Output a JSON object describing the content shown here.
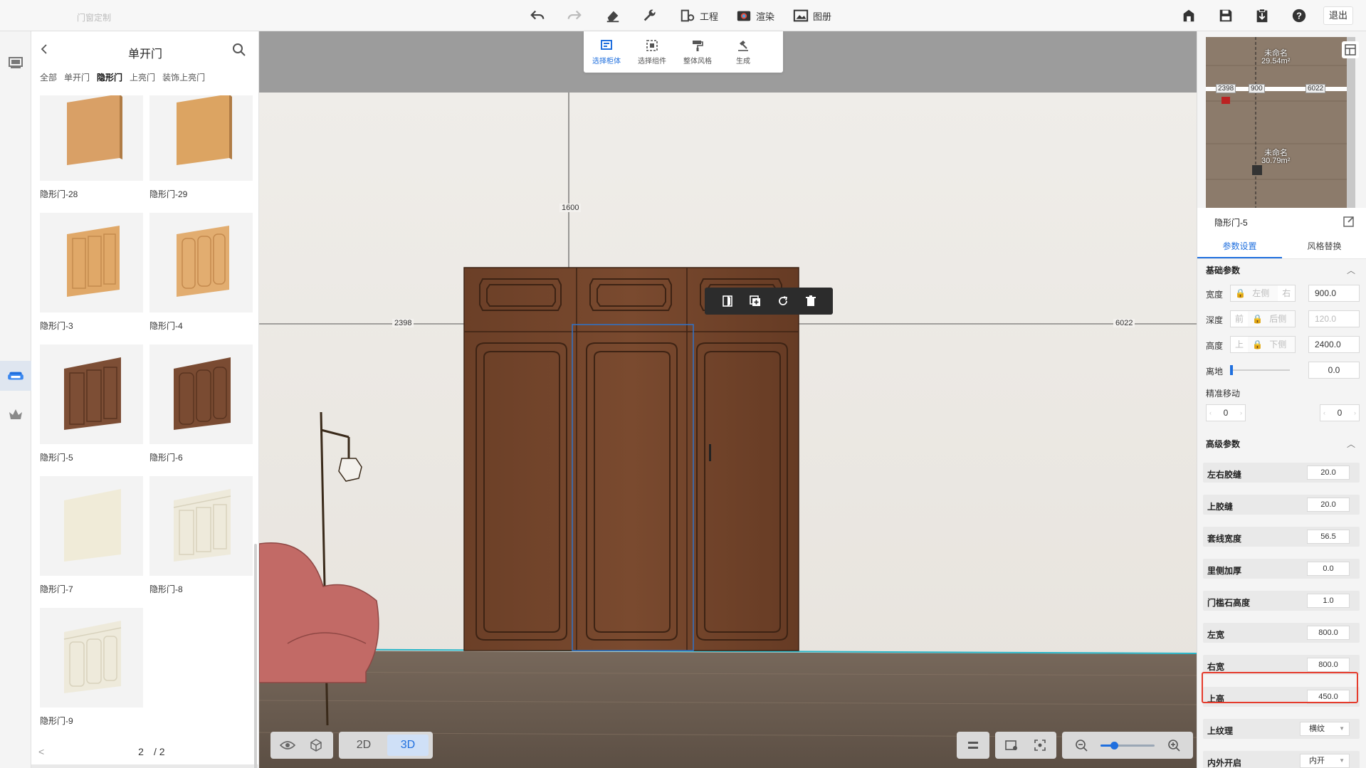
{
  "app": {
    "title": "门窗定制"
  },
  "toolbar": {
    "project_label": "工程",
    "render_label": "渲染",
    "album_label": "图册",
    "exit_label": "退出"
  },
  "catalog": {
    "title": "单开门",
    "tabs": [
      "全部",
      "单开门",
      "隐形门",
      "上亮门",
      "装饰上亮门"
    ],
    "active_tab": "隐形门",
    "items": [
      {
        "name": "隐形门-28",
        "color": "#d9a066"
      },
      {
        "name": "隐形门-29",
        "color": "#dca462"
      },
      {
        "name": "隐形门-3",
        "color": "#e0a868"
      },
      {
        "name": "隐形门-4",
        "color": "#e2ad70"
      },
      {
        "name": "隐形门-5",
        "color": "#7d4e35"
      },
      {
        "name": "隐形门-6",
        "color": "#7a4b32"
      },
      {
        "name": "隐形门-7",
        "color": "#f0ebd8"
      },
      {
        "name": "隐形门-8",
        "color": "#eeeadb"
      },
      {
        "name": "隐形门-9",
        "color": "#eeeadb"
      }
    ],
    "pager": {
      "current": "2",
      "total": "/ 2"
    }
  },
  "palette": {
    "items": [
      {
        "label": "选择柜体",
        "active": true
      },
      {
        "label": "选择组件",
        "active": false
      },
      {
        "label": "整体风格",
        "active": false
      },
      {
        "label": "生成",
        "active": false
      }
    ]
  },
  "viewport": {
    "dims": {
      "top": "1600",
      "left": "2398",
      "right": "6022"
    }
  },
  "view_controls": {
    "mode_2d": "2D",
    "mode_3d": "3D",
    "active_mode": "3D"
  },
  "zoom": {
    "level": 0.25
  },
  "minimap": {
    "room1_name": "未命名",
    "room1_area": "29.54m²",
    "room2_name": "未命名",
    "room2_area": "30.79m²",
    "dim_left": "2398",
    "dim_mid": "900",
    "dim_right": "6022"
  },
  "properties": {
    "title": "隐形门-5",
    "tabs": [
      "参数设置",
      "风格替换"
    ],
    "active_tab": "参数设置",
    "basic_title": "基础参数",
    "basic": {
      "width": {
        "label": "宽度",
        "opt1": "左侧",
        "opt2": "右",
        "value": "900.0"
      },
      "depth": {
        "label": "深度",
        "opt1": "前",
        "opt2": "后侧",
        "value": "120.0"
      },
      "height": {
        "label": "高度",
        "opt1": "上",
        "opt2": "下侧",
        "value": "2400.0"
      },
      "offset": {
        "label": "离地",
        "value": "0.0"
      },
      "fine_move": {
        "label": "精准移动",
        "x": "0",
        "y": "0"
      }
    },
    "advanced_title": "高级参数",
    "advanced": [
      {
        "label": "左右胶缝",
        "value": "20.0"
      },
      {
        "label": "上胶缝",
        "value": "20.0"
      },
      {
        "label": "套线宽度",
        "value": "56.5"
      },
      {
        "label": "里侧加厚",
        "value": "0.0"
      },
      {
        "label": "门槛石高度",
        "value": "1.0"
      },
      {
        "label": "左宽",
        "value": "800.0"
      },
      {
        "label": "右宽",
        "value": "800.0"
      },
      {
        "label": "上高",
        "value": "450.0"
      }
    ],
    "selects": [
      {
        "label": "上纹理",
        "value": "横纹"
      },
      {
        "label": "内外开启",
        "value": "内开"
      }
    ]
  },
  "colors": {
    "accent": "#1f6fde",
    "highlight": "#e53b2c",
    "door_wood": "#6e4228"
  }
}
